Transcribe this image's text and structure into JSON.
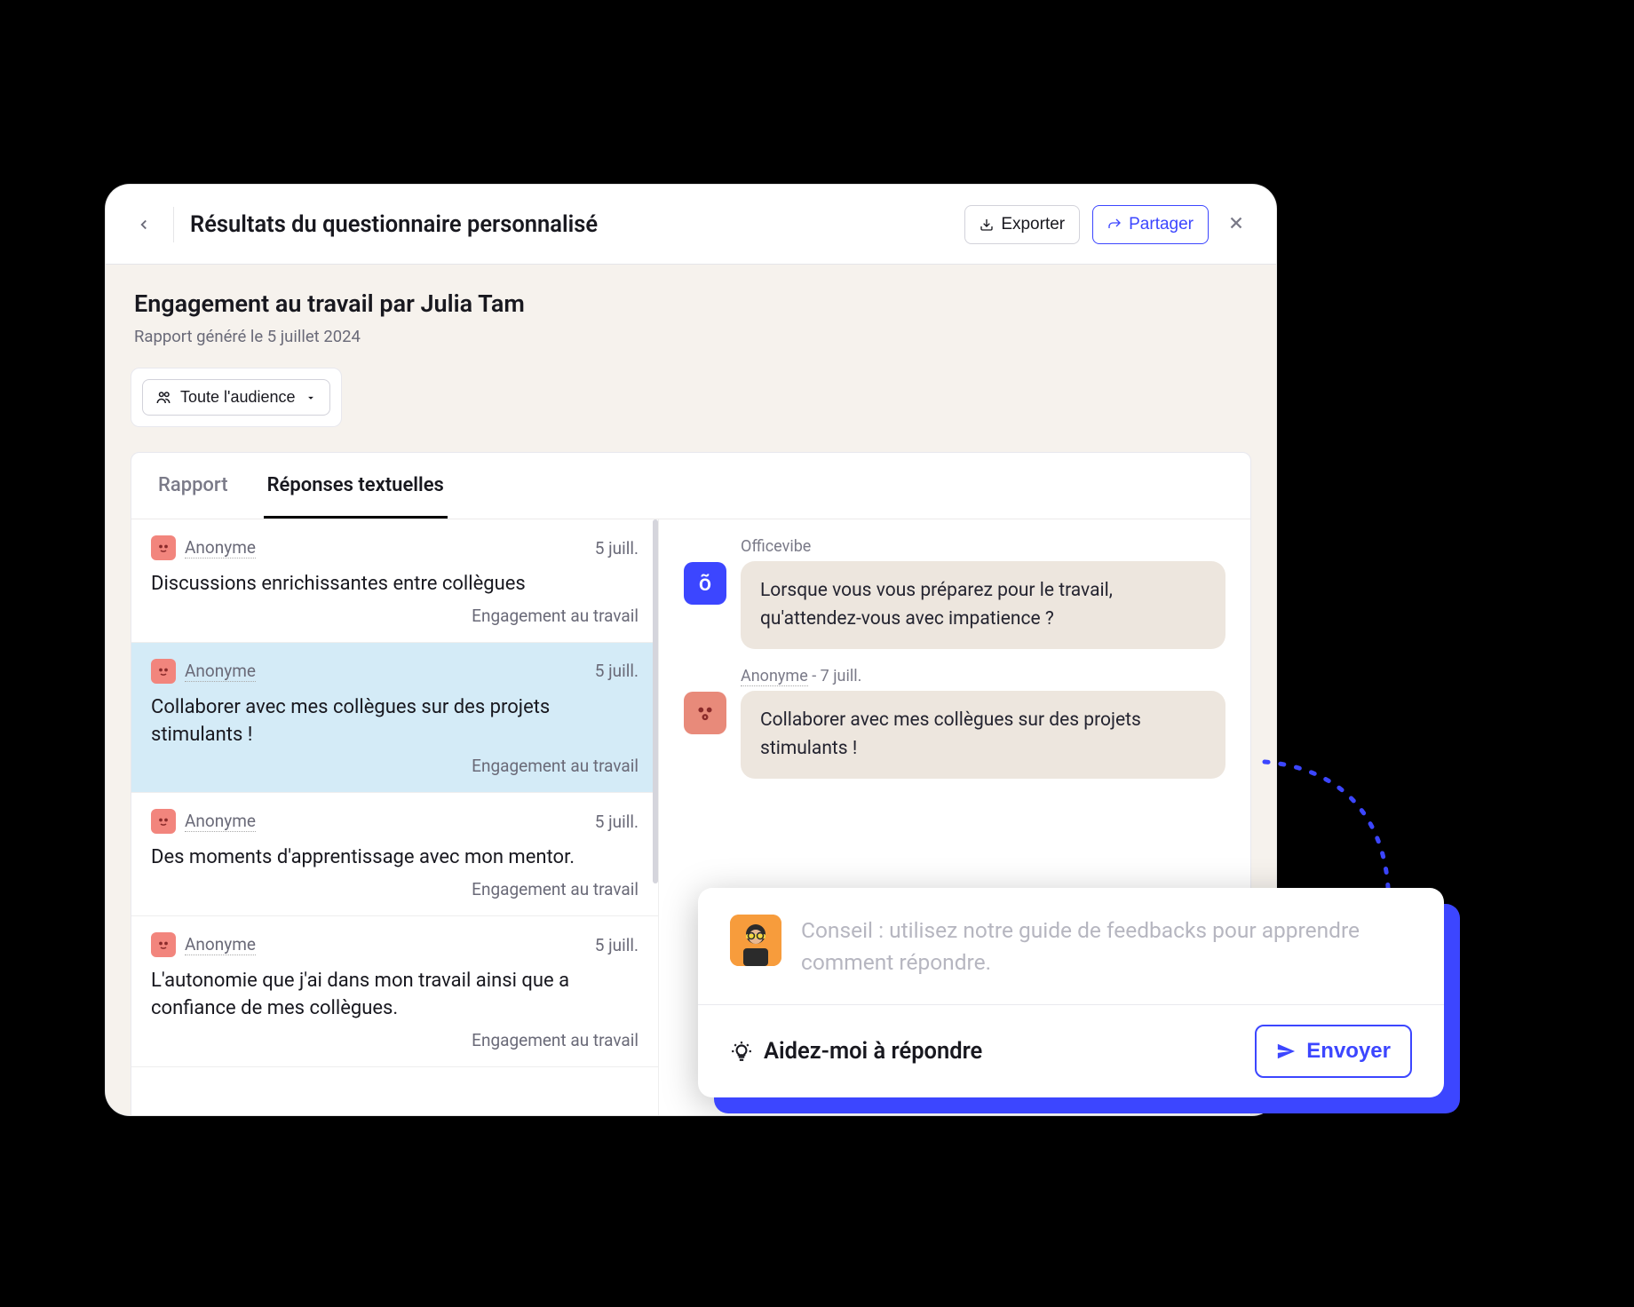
{
  "header": {
    "title": "Résultats du questionnaire personnalisé",
    "export_label": "Exporter",
    "share_label": "Partager"
  },
  "report": {
    "title": "Engagement au travail par Julia Tam",
    "generated": "Rapport généré le 5 juillet 2024",
    "audience_filter": "Toute l'audience"
  },
  "tabs": {
    "tab1": "Rapport",
    "tab2": "Réponses textuelles"
  },
  "responses": [
    {
      "author": "Anonyme",
      "date": "5 juill.",
      "text": "Discussions enrichissantes entre collègues",
      "tag": "Engagement au travail"
    },
    {
      "author": "Anonyme",
      "date": "5 juill.",
      "text": "Collaborer avec mes collègues sur des projets stimulants !",
      "tag": "Engagement au travail"
    },
    {
      "author": "Anonyme",
      "date": "5 juill.",
      "text": "Des moments d'apprentissage avec mon mentor.",
      "tag": "Engagement au travail"
    },
    {
      "author": "Anonyme",
      "date": "5 juill.",
      "text": "L'autonomie que j'ai dans mon travail ainsi que a confiance de mes collègues.",
      "tag": "Engagement au travail"
    }
  ],
  "conversation": {
    "question_sender": "Officevibe",
    "question_text": "Lorsque vous vous préparez pour le travail, qu'attendez-vous avec impatience ?",
    "answer_sender": "Anonyme",
    "answer_date_sep": " - 7 juill.",
    "answer_text": "Collaborer avec mes collègues sur des projets stimulants !"
  },
  "reply": {
    "placeholder": "Conseil : utilisez notre guide de feedbacks pour apprendre comment répondre.",
    "help_label": "Aidez-moi à répondre",
    "send_label": "Envoyer"
  }
}
